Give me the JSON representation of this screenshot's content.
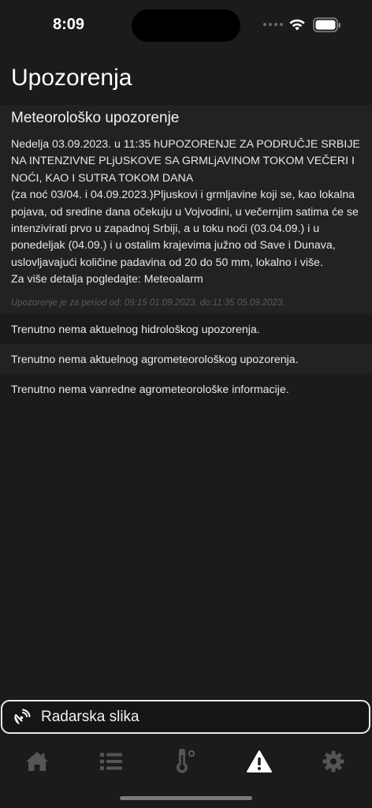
{
  "status_bar": {
    "time": "8:09"
  },
  "page": {
    "title": "Upozorenja"
  },
  "meteo_warning": {
    "title": "Meteorološko upozorenje",
    "body": "Nedelja 03.09.2023. u 11:35 hUPOZORENJE ZA PODRUČJE SRBIJE NA INTENZIVNE PLjUSKOVE SA GRMLjAVINOM TOKOM VEČERI I NOĆI, KAO I SUTRA TOKOM DANA\n(za noć 03/04. i 04.09.2023.)Pljuskovi i grmljavine koji se, kao lokalna pojava, od sredine dana očekuju u Vojvodini, u večernjim satima će se intenzivirati prvo u zapadnoj Srbiji, a u toku noći (03.04.09.) i u ponedeljak (04.09.) i u ostalim krajevima južno od Save i Dunava, uslovljavajući količine padavina od 20 do 50 mm, lokalno i više.\nZa više detalja pogledajte:  Meteoalarm",
    "period": "Upozorenje je za period od: 09:15 01.09.2023. do:11:35 05.09.2023."
  },
  "info_rows": [
    "Trenutno nema aktuelnog hidrološkog upozorenja.",
    "Trenutno nema aktuelnog agrometeorološkog upozorenja.",
    "Trenutno nema vanredne agrometeorološke informacije."
  ],
  "radar": {
    "label": "Radarska slika",
    "icon": "satellite-dish-icon"
  },
  "tab_bar": {
    "tabs": [
      {
        "icon": "home-icon",
        "active": false
      },
      {
        "icon": "list-icon",
        "active": false
      },
      {
        "icon": "thermometer-icon",
        "active": false
      },
      {
        "icon": "warning-icon",
        "active": true
      },
      {
        "icon": "gear-icon",
        "active": false
      }
    ]
  },
  "colors": {
    "background": "#1b1b1b",
    "card": "#222222",
    "text": "#ececec",
    "inactive_icon": "#555555",
    "active_icon": "#ffffff"
  }
}
